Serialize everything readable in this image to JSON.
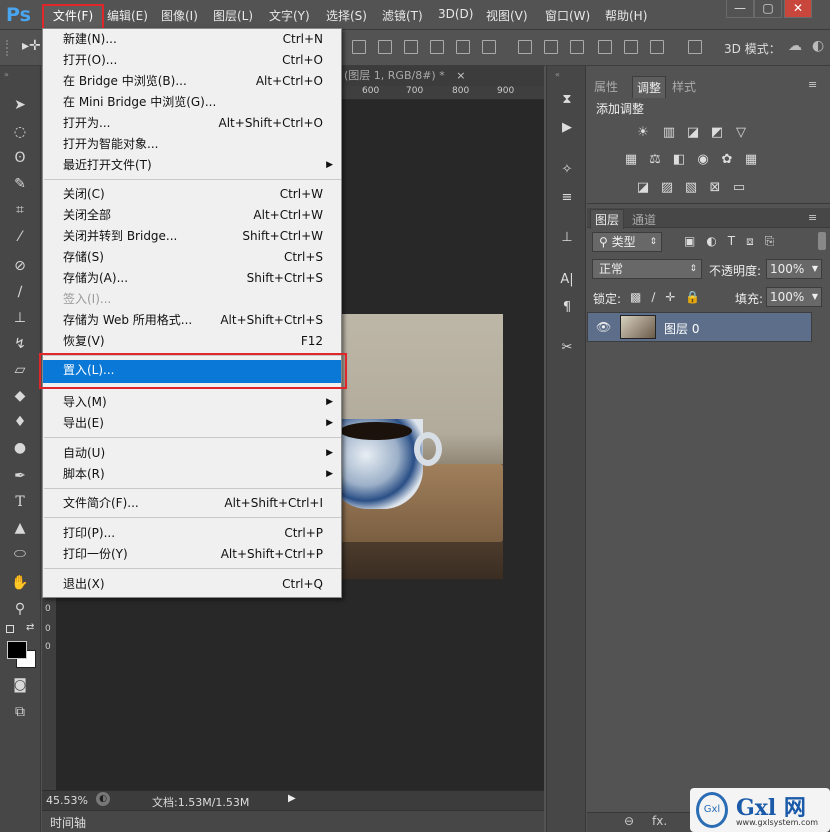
{
  "app": {
    "logo": "Ps"
  },
  "menubar": {
    "items": [
      "文件(F)",
      "编辑(E)",
      "图像(I)",
      "图层(L)",
      "文字(Y)",
      "选择(S)",
      "滤镜(T)",
      "3D(D)",
      "视图(V)",
      "窗口(W)",
      "帮助(H)"
    ]
  },
  "window_controls": {
    "minimize": "—",
    "restore": "▢",
    "close": "✕"
  },
  "optionsbar": {
    "mode_label": "3D 模式："
  },
  "document": {
    "tab_title": "(图层 1, RGB/8#) *",
    "tab_close": "×",
    "ruler_ticks": [
      "600",
      "700",
      "800",
      "900"
    ],
    "ruler_v_digits": [
      "0",
      "0",
      "0"
    ]
  },
  "file_menu": {
    "items": [
      {
        "label": "新建(N)...",
        "shortcut": "Ctrl+N"
      },
      {
        "label": "打开(O)...",
        "shortcut": "Ctrl+O"
      },
      {
        "label": "在 Bridge 中浏览(B)...",
        "shortcut": "Alt+Ctrl+O"
      },
      {
        "label": "在 Mini Bridge 中浏览(G)...",
        "shortcut": ""
      },
      {
        "label": "打开为...",
        "shortcut": "Alt+Shift+Ctrl+O"
      },
      {
        "label": "打开为智能对象...",
        "shortcut": ""
      },
      {
        "label": "最近打开文件(T)",
        "shortcut": "",
        "submenu": true
      },
      {
        "label": "关闭(C)",
        "shortcut": "Ctrl+W"
      },
      {
        "label": "关闭全部",
        "shortcut": "Alt+Ctrl+W"
      },
      {
        "label": "关闭并转到 Bridge...",
        "shortcut": "Shift+Ctrl+W"
      },
      {
        "label": "存储(S)",
        "shortcut": "Ctrl+S"
      },
      {
        "label": "存储为(A)...",
        "shortcut": "Shift+Ctrl+S"
      },
      {
        "label": "签入(I)...",
        "shortcut": "",
        "disabled": true
      },
      {
        "label": "存储为 Web 所用格式...",
        "shortcut": "Alt+Shift+Ctrl+S"
      },
      {
        "label": "恢复(V)",
        "shortcut": "F12"
      },
      {
        "label": "置入(L)...",
        "shortcut": "",
        "highlighted": true
      },
      {
        "label": "导入(M)",
        "shortcut": "",
        "submenu": true
      },
      {
        "label": "导出(E)",
        "shortcut": "",
        "submenu": true
      },
      {
        "label": "自动(U)",
        "shortcut": "",
        "submenu": true
      },
      {
        "label": "脚本(R)",
        "shortcut": "",
        "submenu": true
      },
      {
        "label": "文件简介(F)...",
        "shortcut": "Alt+Shift+Ctrl+I"
      },
      {
        "label": "打印(P)...",
        "shortcut": "Ctrl+P"
      },
      {
        "label": "打印一份(Y)",
        "shortcut": "Alt+Shift+Ctrl+P"
      },
      {
        "label": "退出(X)",
        "shortcut": "Ctrl+Q"
      }
    ]
  },
  "status": {
    "zoom": "45.53%",
    "doc_size": "文档:1.53M/1.53M"
  },
  "timeline": {
    "label": "时间轴"
  },
  "adjust_panel": {
    "tabs": [
      "属性",
      "调整",
      "样式"
    ],
    "title": "添加调整"
  },
  "layers_panel": {
    "tabs": [
      "图层",
      "通道"
    ],
    "filter_kind": "类型",
    "blend_mode": "正常",
    "opacity_label": "不透明度:",
    "opacity": "100%",
    "lock_label": "锁定:",
    "fill_label": "填充:",
    "fill": "100%",
    "layers": [
      {
        "name": "图层 0"
      }
    ],
    "footer": [
      "⊖",
      "fx."
    ]
  },
  "watermark": {
    "brand": "Gxl 网",
    "url": "www.gxlsystem.com"
  },
  "colors": {
    "highlight": "#0a78d7",
    "annotation_red": "#e0262b",
    "layer_selected": "#5c6e8a"
  }
}
